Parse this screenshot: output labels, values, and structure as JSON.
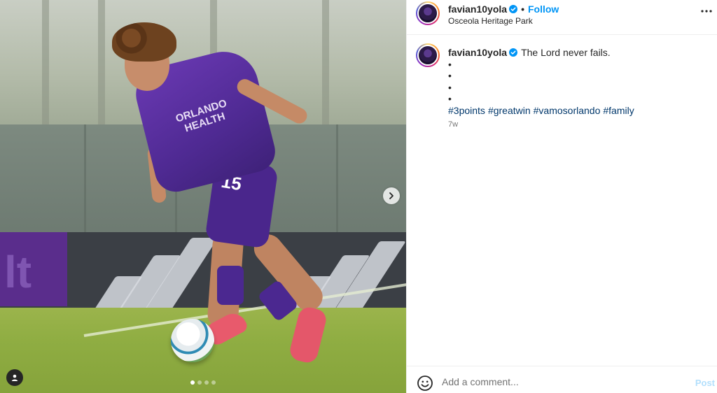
{
  "post": {
    "username": "favian10yola",
    "location": "Osceola Heritage Park",
    "follow_label": "Follow",
    "separator": "•",
    "caption": "The Lord never fails.",
    "bullets": [
      "•",
      "•",
      "•",
      "•"
    ],
    "hashtags": [
      "#3points",
      "#greatwin",
      "#vamosorlando",
      "#family"
    ],
    "time_ago": "7w",
    "verified": true
  },
  "media": {
    "jersey_text": "ORLANDO HEALTH",
    "jersey_number": "15",
    "carousel_total": 4,
    "carousel_active": 1
  },
  "comment": {
    "placeholder": "Add a comment...",
    "post_label": "Post"
  },
  "colors": {
    "link_blue": "#0095f6",
    "hashtag": "#00376b",
    "muted": "#737373",
    "post_disabled": "#b2dffc"
  },
  "icons": {
    "more": "more-horizontal-icon",
    "emoji": "emoji-icon",
    "verified": "verified-badge-icon",
    "next": "chevron-right-icon",
    "tag": "user-tag-icon"
  }
}
